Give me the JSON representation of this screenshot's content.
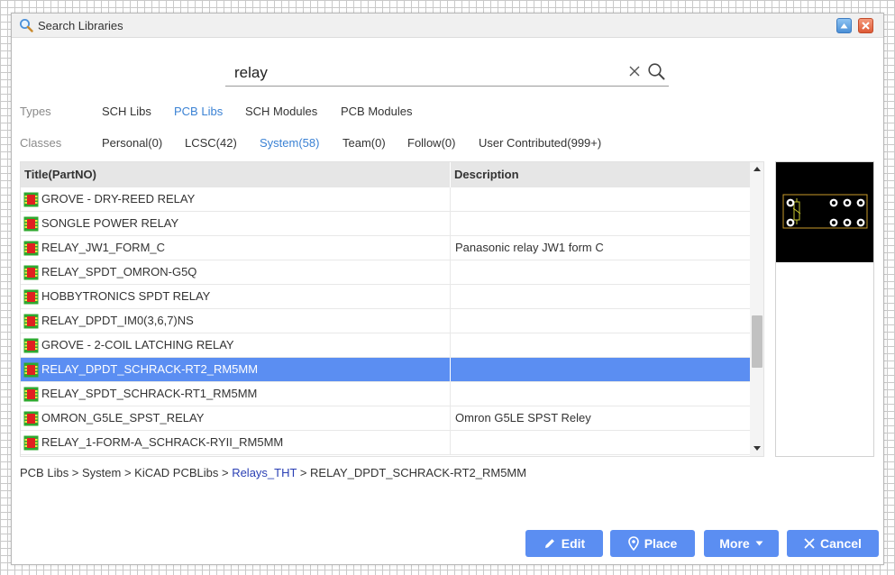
{
  "window": {
    "title": "Search Libraries"
  },
  "search": {
    "value": "relay"
  },
  "types": {
    "label": "Types",
    "items": [
      {
        "label": "SCH Libs",
        "active": false
      },
      {
        "label": "PCB Libs",
        "active": true
      },
      {
        "label": "SCH Modules",
        "active": false
      },
      {
        "label": "PCB Modules",
        "active": false
      }
    ]
  },
  "classes": {
    "label": "Classes",
    "items": [
      {
        "label": "Personal(0)",
        "active": false
      },
      {
        "label": "LCSC(42)",
        "active": false
      },
      {
        "label": "System(58)",
        "active": true
      },
      {
        "label": "Team(0)",
        "active": false
      },
      {
        "label": "Follow(0)",
        "active": false
      },
      {
        "label": "User Contributed(999+)",
        "active": false
      }
    ]
  },
  "table": {
    "columns": [
      "Title(PartNO)",
      "Description"
    ],
    "rows": [
      {
        "title": "GROVE - DRY-REED RELAY",
        "description": ""
      },
      {
        "title": "SONGLE POWER RELAY",
        "description": ""
      },
      {
        "title": "RELAY_JW1_FORM_C",
        "description": "Panasonic relay JW1 form C"
      },
      {
        "title": "RELAY_SPDT_OMRON-G5Q",
        "description": ""
      },
      {
        "title": "HOBBYTRONICS SPDT RELAY",
        "description": ""
      },
      {
        "title": "RELAY_DPDT_IM0(3,6,7)NS",
        "description": ""
      },
      {
        "title": "GROVE - 2-COIL LATCHING RELAY",
        "description": ""
      },
      {
        "title": "RELAY_DPDT_SCHRACK-RT2_RM5MM",
        "description": ""
      },
      {
        "title": "RELAY_SPDT_SCHRACK-RT1_RM5MM",
        "description": ""
      },
      {
        "title": "OMRON_G5LE_SPST_RELAY",
        "description": "Omron G5LE SPST Reley"
      },
      {
        "title": "RELAY_1-FORM-A_SCHRACK-RYII_RM5MM",
        "description": ""
      }
    ],
    "selected_index": 7
  },
  "breadcrumb": {
    "part1": "PCB Libs > System > KiCAD PCBLibs > ",
    "link": "Relays_THT",
    "part2": " > RELAY_DPDT_SCHRACK-RT2_RM5MM"
  },
  "buttons": {
    "edit": "Edit",
    "place": "Place",
    "more": "More",
    "cancel": "Cancel"
  },
  "colors": {
    "accent": "#5b8ef2",
    "active_filter": "#3b82d4",
    "link": "#2a3fb4",
    "preview_bg": "#000000"
  }
}
